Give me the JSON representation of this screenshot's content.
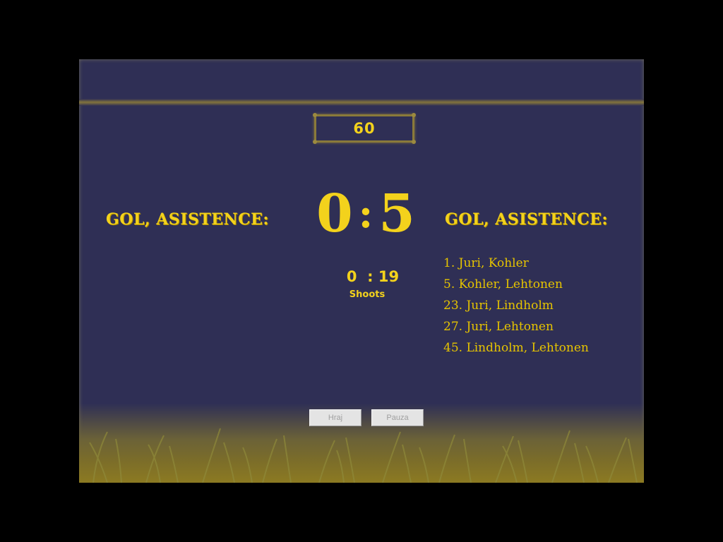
{
  "timer": "60",
  "score": {
    "home": "0",
    "separator": ":",
    "away": "5"
  },
  "headings": {
    "left": "GOL, ASISTENCE:",
    "right": "GOL, ASISTENCE:"
  },
  "shots": {
    "text": "0  : 19",
    "label": "Shoots"
  },
  "goals": [
    "1. Juri, Kohler",
    "5. Kohler, Lehtonen",
    "23. Juri, Lindholm",
    "27. Juri, Lehtonen",
    "45. Lindholm, Lehtonen"
  ],
  "buttons": {
    "play": "Hraj",
    "pause": "Pauza"
  },
  "colors": {
    "background": "#2f2f55",
    "text": "#f3d21c",
    "rail": "#8a7a3a"
  }
}
